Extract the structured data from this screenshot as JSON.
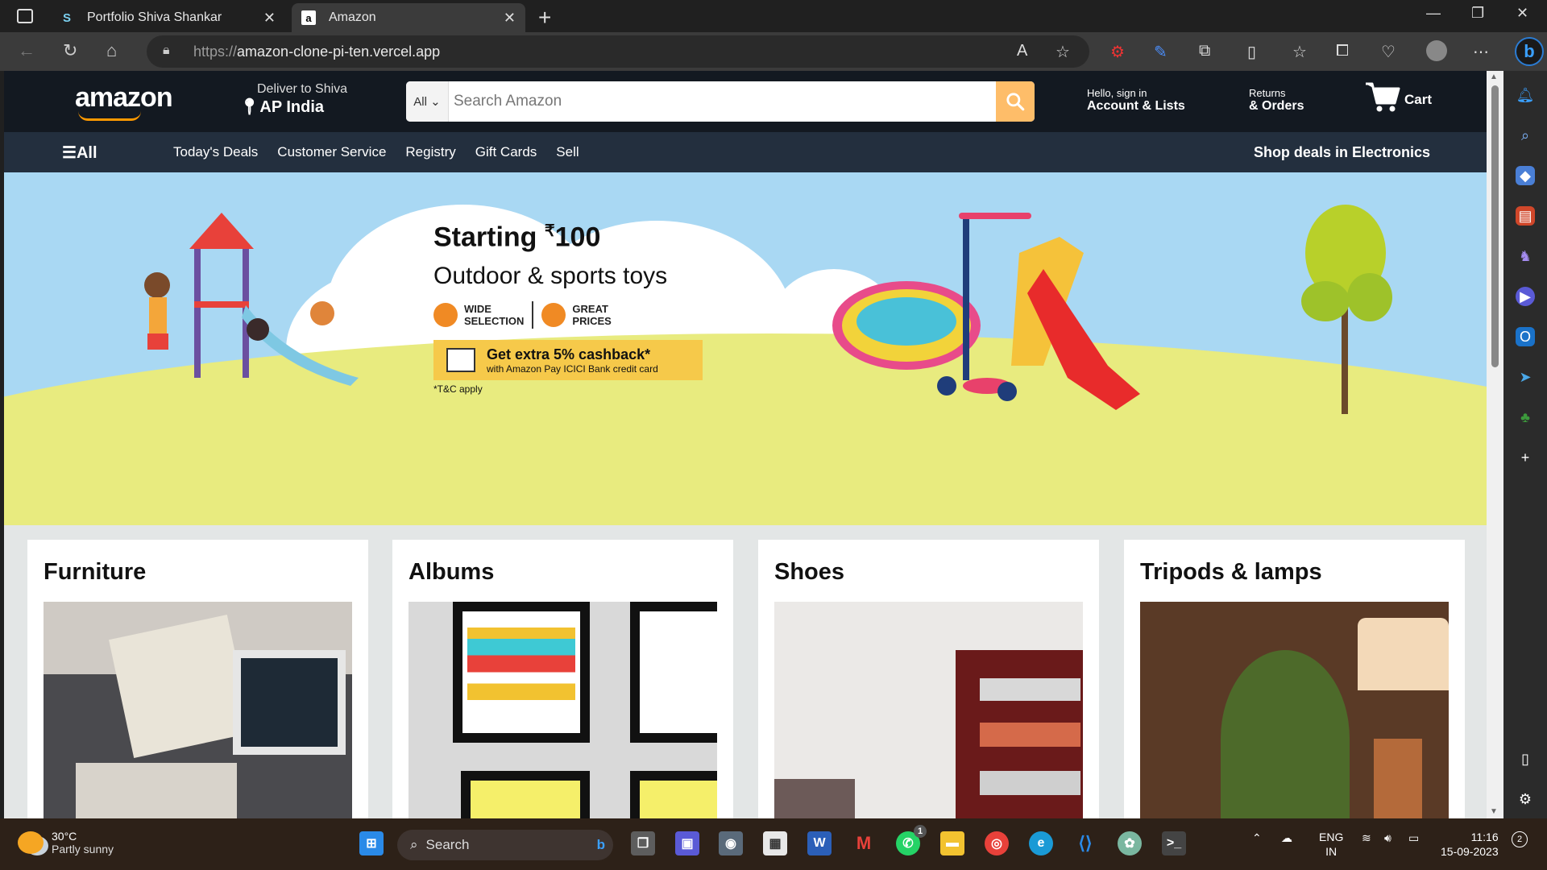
{
  "browser": {
    "tabs": [
      {
        "label": "Portfolio Shiva Shankar",
        "favicon": "S",
        "active": false
      },
      {
        "label": "Amazon",
        "favicon": "a",
        "active": true
      }
    ],
    "url_scheme": "https://",
    "url_host": "amazon-clone-pi-ten.vercel.app"
  },
  "amazon": {
    "logo": "amazon",
    "deliver_line1": "Deliver to Shiva",
    "deliver_line2": "AP India",
    "search_category": "All",
    "search_placeholder": "Search Amazon",
    "account_small": "Hello, sign in",
    "account_big": "Account & Lists",
    "returns_small": "Returns",
    "returns_big": "& Orders",
    "cart_label": "Cart",
    "nav_all": "All",
    "nav_links": [
      "Today's Deals",
      "Customer Service",
      "Registry",
      "Gift Cards",
      "Sell"
    ],
    "nav_deals": "Shop deals in Electronics"
  },
  "hero": {
    "headline_prefix": "Starting ",
    "headline_currency": "₹",
    "headline_value": "100",
    "subheadline": "Outdoor & sports toys",
    "badge1_l1": "WIDE",
    "badge1_l2": "SELECTION",
    "badge2_l1": "GREAT",
    "badge2_l2": "PRICES",
    "cashback_title": "Get extra 5% cashback*",
    "cashback_sub": "with Amazon Pay ICICI Bank credit card",
    "tnc": "*T&C apply"
  },
  "cards": [
    {
      "title": "Furniture"
    },
    {
      "title": "Albums"
    },
    {
      "title": "Shoes"
    },
    {
      "title": "Tripods & lamps"
    }
  ],
  "taskbar": {
    "temp": "30°C",
    "weather": "Partly sunny",
    "search": "Search",
    "lang1": "ENG",
    "lang2": "IN",
    "time": "11:16",
    "date": "15-09-2023",
    "notif_count": "2",
    "whatsapp_badge": "1"
  },
  "colors": {
    "amazon_header": "#131921",
    "amazon_nav": "#232f3e",
    "search_button": "#febd69",
    "accent_orange": "#ff9900"
  }
}
